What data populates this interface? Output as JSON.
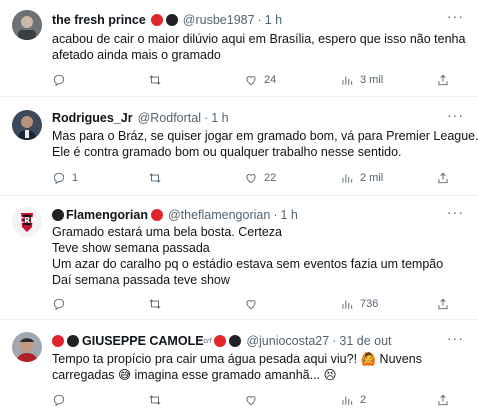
{
  "tweets": [
    {
      "name": "the fresh prince",
      "handle": "@rusbe1987",
      "time": "1 h",
      "lines": [
        "acabou de cair o maior dilúvio aqui em Brasília, espero que isso não tenha",
        "afetado ainda mais o gramado"
      ],
      "replies": "",
      "retweets": "",
      "likes": "24",
      "views": "3 mil"
    },
    {
      "name": "Rodrigues_Jr",
      "handle": "@Rodfortal",
      "time": "1 h",
      "lines": [
        "Mas para o Bráz, se quiser jogar em gramado bom, vá para Premier League.",
        "Ele é contra gramado bom ou qualquer trabalho nesse sentido."
      ],
      "replies": "1",
      "retweets": "",
      "likes": "22",
      "views": "2 mil"
    },
    {
      "name": "Flamengorian",
      "handle": "@theflamengorian",
      "time": "1 h",
      "lines": [
        "Gramado estará uma bela bosta. Certeza",
        "Teve show semana passada",
        "Um azar do caralho pq o estádio estava sem eventos fazia um tempão",
        "Daí semana passada teve show"
      ],
      "replies": "",
      "retweets": "",
      "likes": "",
      "views": "736"
    },
    {
      "name": "GIUSEPPE CAMOLE",
      "badge": "crf",
      "handle": "@juniocosta27",
      "time": "31 de out",
      "lines": [
        "Tempo ta propício pra cair uma água pesada aqui viu?! 🙆 Nuvens",
        "carregadas 😅 imagina esse gramado amanhã... 😣"
      ],
      "replies": "",
      "retweets": "",
      "likes": "",
      "views": "2"
    }
  ],
  "separator": "·",
  "more_glyph": "···"
}
